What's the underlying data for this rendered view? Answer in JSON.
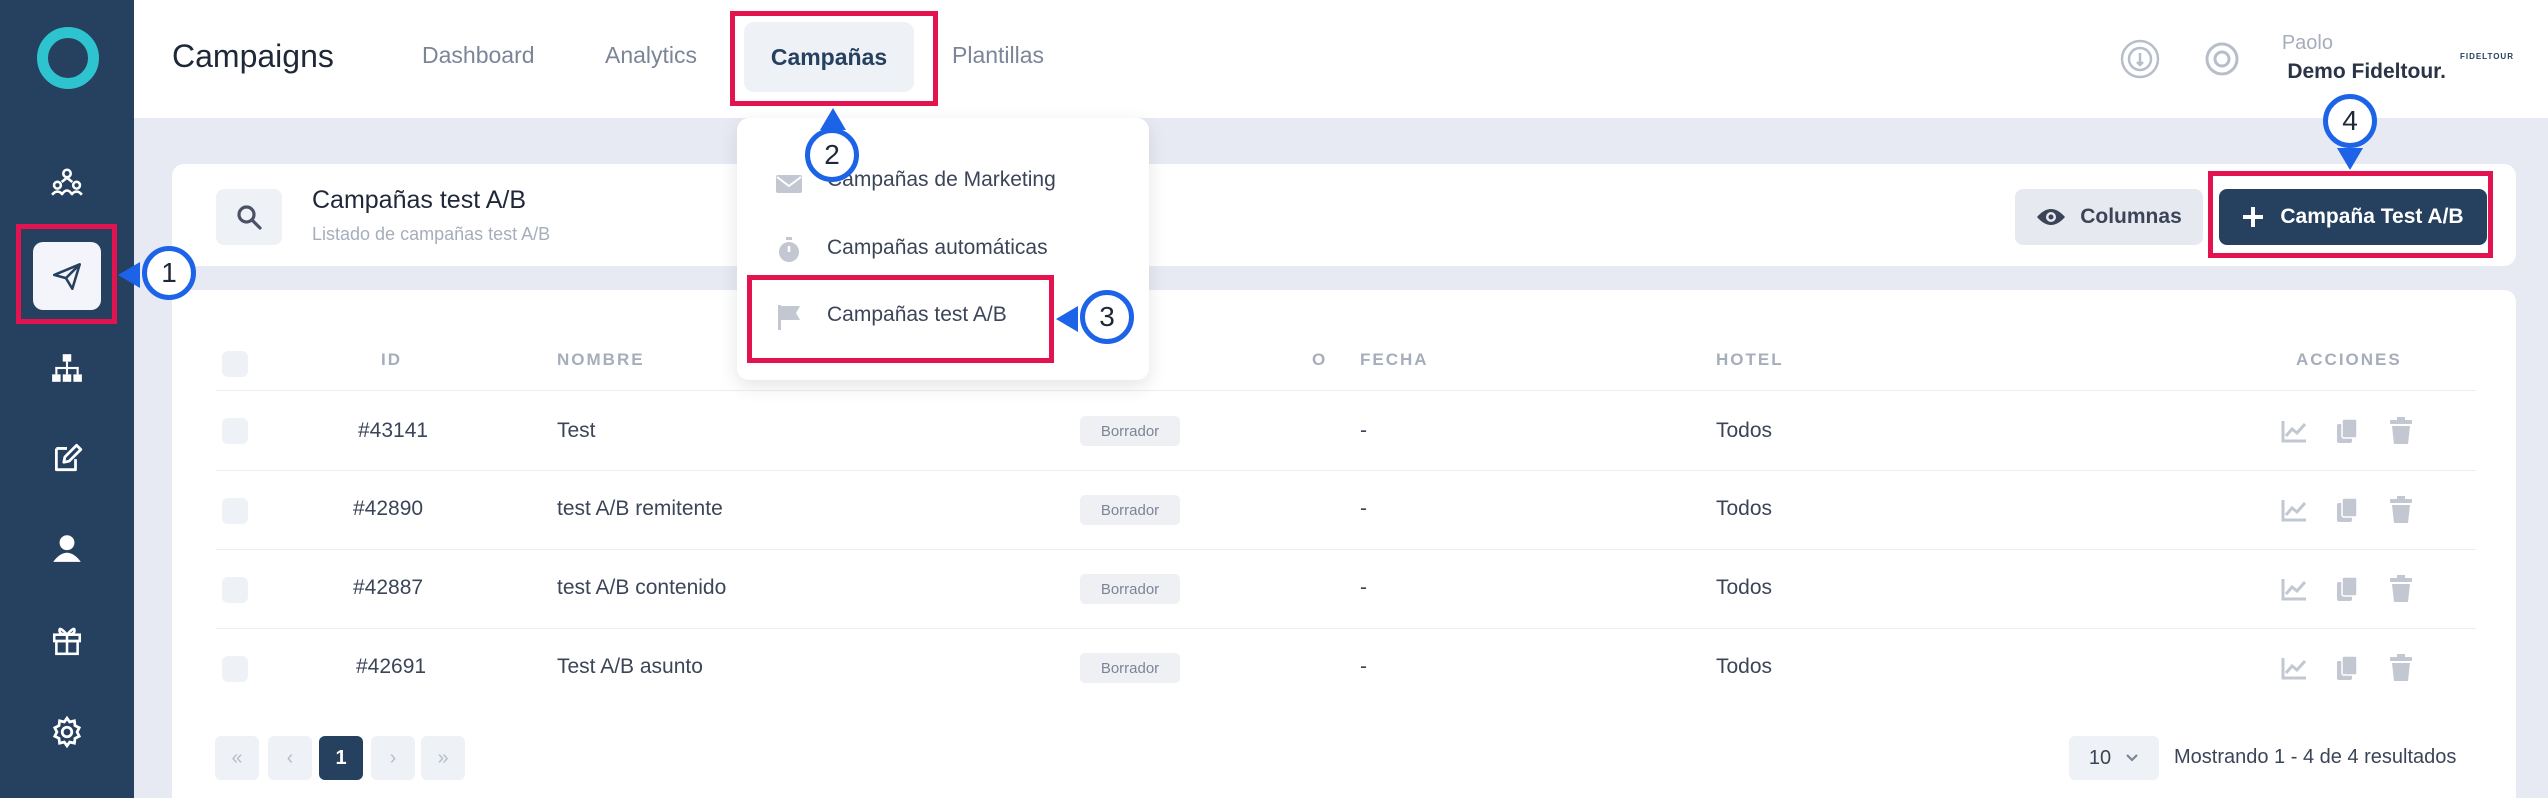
{
  "sidebar": {
    "items": [
      {
        "icon": "audience-icon"
      },
      {
        "icon": "send-icon",
        "active": true
      },
      {
        "icon": "sitemap-icon"
      },
      {
        "icon": "edit-icon"
      },
      {
        "icon": "user-icon"
      },
      {
        "icon": "gift-icon"
      },
      {
        "icon": "gear-icon"
      }
    ]
  },
  "header": {
    "title": "Campaigns",
    "tabs": [
      {
        "label": "Dashboard"
      },
      {
        "label": "Analytics"
      },
      {
        "label": "Campañas",
        "active": true
      },
      {
        "label": "Plantillas"
      }
    ],
    "user_name": "Paolo",
    "user_company": "Demo Fideltour.",
    "brand": "FIDELTOUR"
  },
  "dropdown": {
    "items": [
      {
        "label": "Campañas de Marketing",
        "icon": "envelope-icon"
      },
      {
        "label": "Campañas automáticas",
        "icon": "stopwatch-icon"
      },
      {
        "label": "Campañas test A/B",
        "icon": "flag-icon"
      }
    ]
  },
  "page": {
    "title": "Campañas test A/B",
    "subtitle": "Listado de campañas test A/B",
    "columns_label": "Columnas",
    "new_label": "Campaña Test A/B"
  },
  "table": {
    "headers": {
      "id": "ID",
      "name": "NOMBRE",
      "status": "O",
      "date": "FECHA",
      "hotel": "HOTEL",
      "actions": "ACCIONES"
    },
    "rows": [
      {
        "id": "#43141",
        "name": "Test",
        "status": "Borrador",
        "date": "-",
        "hotel": "Todos"
      },
      {
        "id": "#42890",
        "name": "test A/B remitente",
        "status": "Borrador",
        "date": "-",
        "hotel": "Todos"
      },
      {
        "id": "#42887",
        "name": "test A/B contenido",
        "status": "Borrador",
        "date": "-",
        "hotel": "Todos"
      },
      {
        "id": "#42691",
        "name": "Test A/B asunto",
        "status": "Borrador",
        "date": "-",
        "hotel": "Todos"
      }
    ]
  },
  "pagination": {
    "first": "«",
    "prev": "‹",
    "current": "1",
    "next": "›",
    "last": "»",
    "per_page": "10",
    "showing": "Mostrando 1 - 4 de 4 resultados"
  },
  "annotations": {
    "m1": "1",
    "m2": "2",
    "m3": "3",
    "m4": "4"
  },
  "colors": {
    "sidebar": "#26405f",
    "accent": "#2ec4cf",
    "highlight": "#e3134f",
    "marker": "#1d63e8"
  }
}
